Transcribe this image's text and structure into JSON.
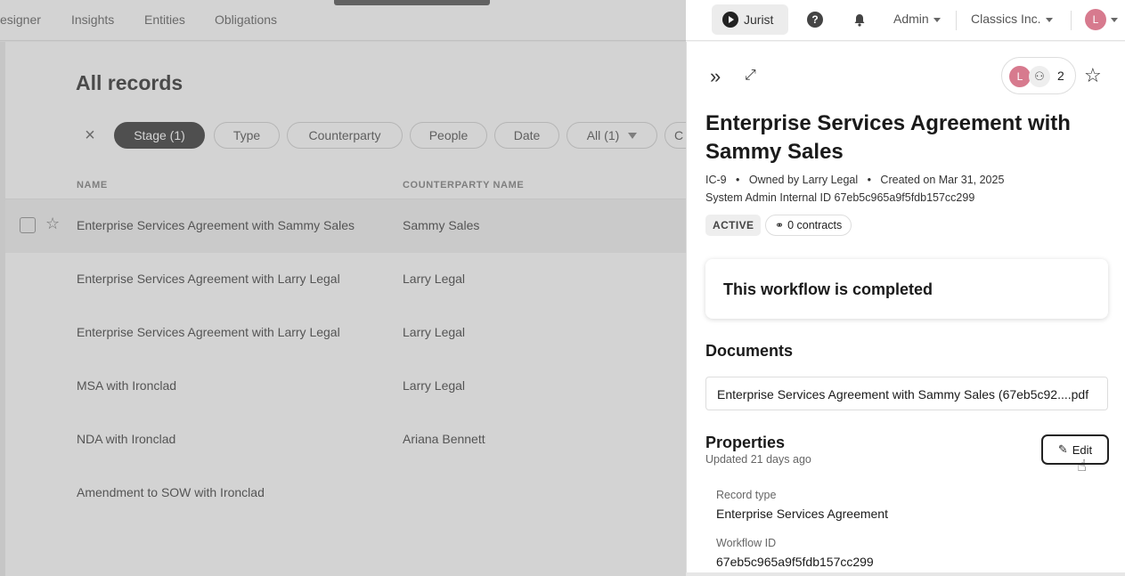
{
  "topnav": {
    "items": [
      "esigner",
      "Insights",
      "Entities",
      "Obligations"
    ],
    "jurist_label": "Jurist",
    "admin_label": "Admin",
    "org_label": "Classics Inc.",
    "avatar_initial": "L"
  },
  "list": {
    "title": "All records",
    "filters": [
      {
        "label": "Stage (1)",
        "active": true
      },
      {
        "label": "Type",
        "active": false
      },
      {
        "label": "Counterparty",
        "active": false
      },
      {
        "label": "People",
        "active": false
      },
      {
        "label": "Date",
        "active": false
      },
      {
        "label": "All (1)",
        "active": false
      },
      {
        "label": "C",
        "active": false
      }
    ],
    "columns": {
      "name": "NAME",
      "counterparty": "COUNTERPARTY NAME"
    },
    "rows": [
      {
        "name": "Enterprise Services Agreement with Sammy Sales",
        "counterparty": "Sammy Sales"
      },
      {
        "name": "Enterprise Services Agreement with Larry Legal",
        "counterparty": "Larry Legal"
      },
      {
        "name": "Enterprise Services Agreement with Larry Legal",
        "counterparty": "Larry Legal"
      },
      {
        "name": "MSA with Ironclad",
        "counterparty": "Larry Legal"
      },
      {
        "name": "NDA with Ironclad",
        "counterparty": "Ariana Bennett"
      },
      {
        "name": "Amendment to SOW with Ironclad",
        "counterparty": ""
      }
    ]
  },
  "panel": {
    "collaborator_initial": "L",
    "collaborator_count": "2",
    "title": "Enterprise Services Agreement with Sammy Sales",
    "meta_id": "IC-9",
    "meta_owner": "Owned by Larry Legal",
    "meta_created": "Created on Mar 31, 2025",
    "internal_id": "System Admin Internal ID 67eb5c965a9f5fdb157cc299",
    "status": "ACTIVE",
    "contracts": "0 contracts",
    "workflow_status": "This workflow is completed",
    "documents_heading": "Documents",
    "document_name": "Enterprise Services Agreement with Sammy Sales (67eb5c92....pdf",
    "properties_heading": "Properties",
    "updated": "Updated 21 days ago",
    "edit_label": "Edit",
    "properties": [
      {
        "label": "Record type",
        "value": "Enterprise Services Agreement"
      },
      {
        "label": "Workflow ID",
        "value": "67eb5c965a9f5fdb157cc299"
      }
    ]
  }
}
